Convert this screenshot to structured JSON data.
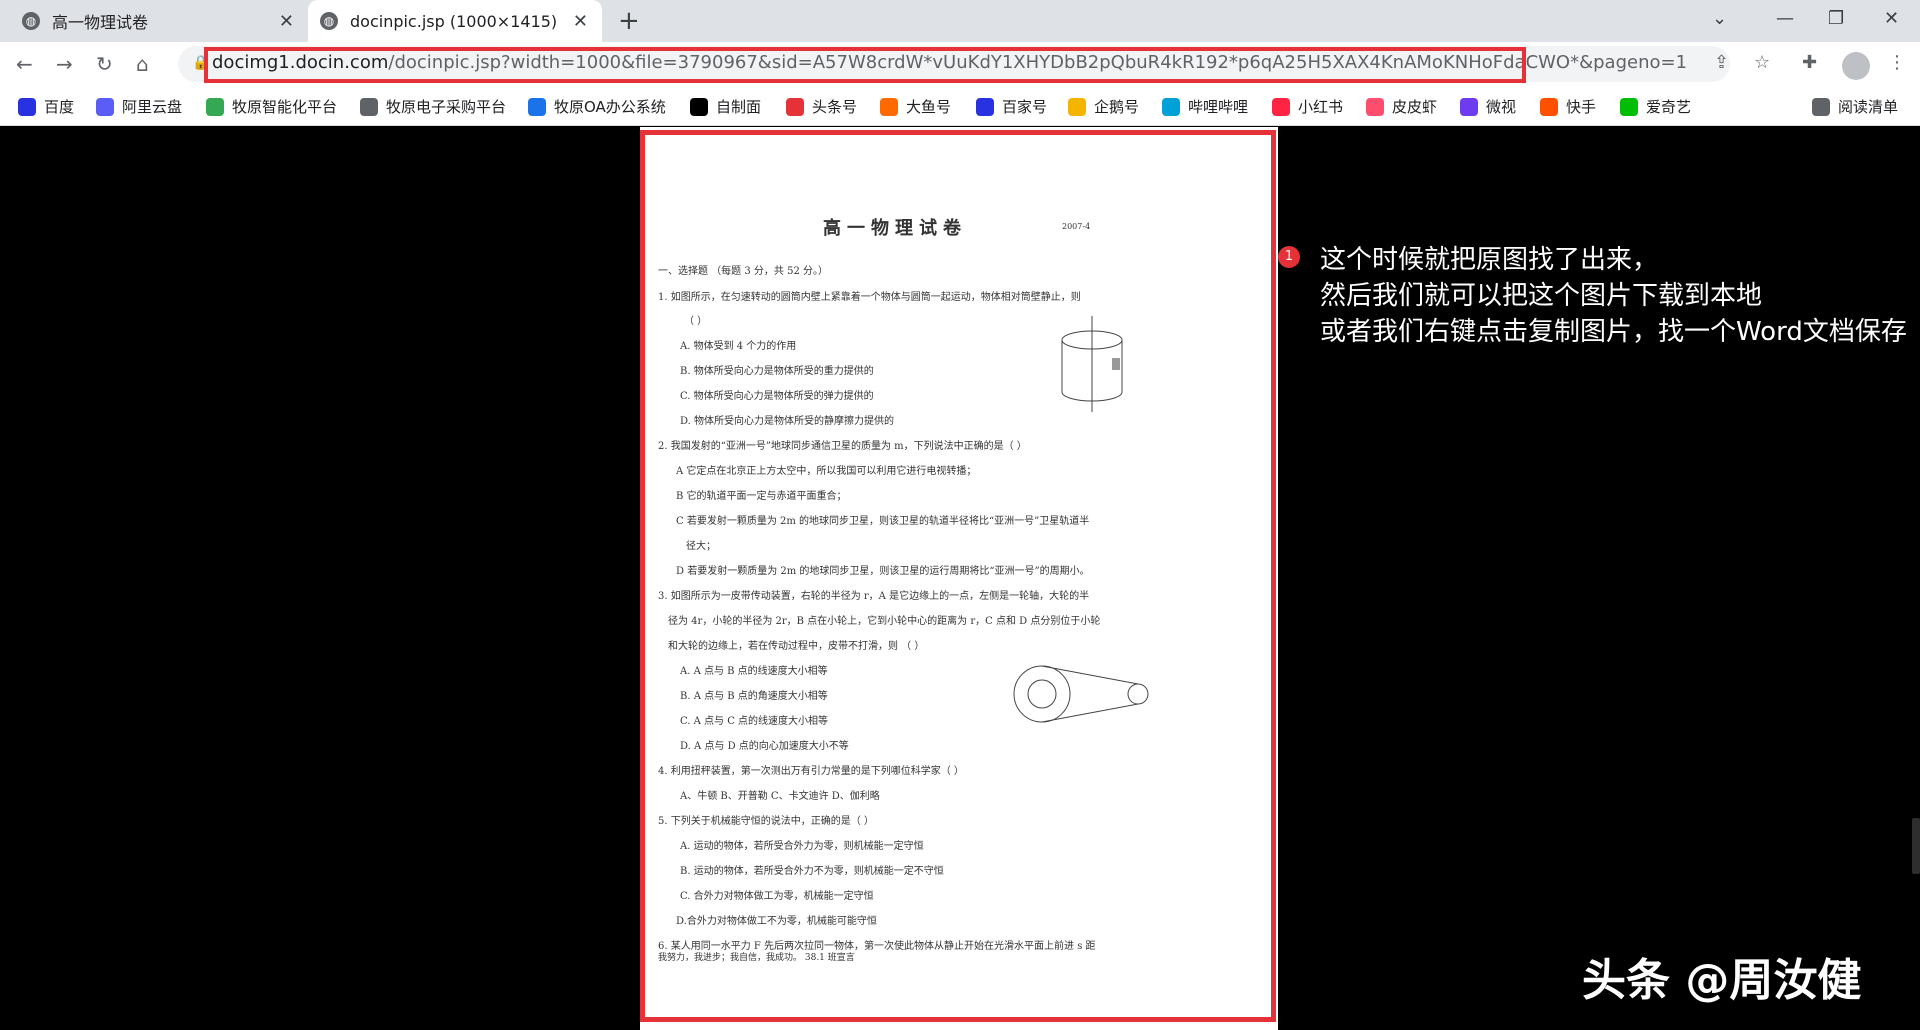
{
  "tabs": [
    {
      "title": "高一物理试卷"
    },
    {
      "title": "docinpic.jsp (1000×1415)"
    }
  ],
  "address": {
    "domain": "docimg1.docin.com",
    "path": "/docinpic.jsp?width=1000&file=3790967&sid=A57W8crdW*vUuKdY1XHYDbB2pQbuR4kR192*p6qA25H5XAX4KnAMoKNHoFdaCWO*&pageno=1"
  },
  "bookmarks": [
    {
      "label": "百度",
      "color": "#2932e1"
    },
    {
      "label": "阿里云盘",
      "color": "#5b5ef6"
    },
    {
      "label": "牧原智能化平台",
      "color": "#34a853"
    },
    {
      "label": "牧原电子采购平台",
      "color": "#5f6368"
    },
    {
      "label": "牧原OA办公系统",
      "color": "#1a73e8"
    },
    {
      "label": "自制面",
      "color": "#000000"
    },
    {
      "label": "头条号",
      "color": "#e53238"
    },
    {
      "label": "大鱼号",
      "color": "#ff6a00"
    },
    {
      "label": "百家号",
      "color": "#2932e1"
    },
    {
      "label": "企鹅号",
      "color": "#f4b400"
    },
    {
      "label": "哔哩哔哩",
      "color": "#00a1d6"
    },
    {
      "label": "小红书",
      "color": "#ff2442"
    },
    {
      "label": "皮皮虾",
      "color": "#ff4d6d"
    },
    {
      "label": "微视",
      "color": "#6e3cf0"
    },
    {
      "label": "快手",
      "color": "#ff5000"
    },
    {
      "label": "爱奇艺",
      "color": "#00be06"
    },
    {
      "label": "阅读清单",
      "color": "#5f6368"
    }
  ],
  "document": {
    "title": "高一物理试卷",
    "date": "2007-4",
    "lines": [
      "一、选择题 （每题 3 分，共 52 分。）",
      "1. 如图所示，在匀速转动的圆筒内壁上紧靠着一个物体与圆筒一起运动，物体相对筒壁静止，则",
      "（      ）",
      "A. 物体受到 4 个力的作用",
      "B. 物体所受向心力是物体所受的重力提供的",
      "C. 物体所受向心力是物体所受的弹力提供的",
      "D. 物体所受向心力是物体所受的静摩擦力提供的",
      "2. 我国发射的“亚洲一号”地球同步通信卫星的质量为 m，下列说法中正确的是（      ）",
      "A 它定点在北京正上方太空中，所以我国可以利用它进行电视转播；",
      "B 它的轨道平面一定与赤道平面重合；",
      "C 若要发射一颗质量为 2m 的地球同步卫星，则该卫星的轨道半径将比“亚洲一号”卫星轨道半",
      "径大；",
      "D 若要发射一颗质量为 2m 的地球同步卫星，则该卫星的运行周期将比“亚洲一号”的周期小。",
      "3. 如图所示为一皮带传动装置，右轮的半径为 r，A 是它边缘上的一点，左侧是一轮轴，大轮的半",
      "径为 4r，小轮的半径为 2r，B 点在小轮上，它到小轮中心的距离为 r，C 点和 D 点分别位于小轮",
      "和大轮的边缘上，若在传动过程中，皮带不打滑，则            （      ）",
      "A. A 点与 B 点的线速度大小相等",
      "B. A 点与 B 点的角速度大小相等",
      "C. A 点与 C 点的线速度大小相等",
      "D. A 点与 D 点的向心加速度大小不等",
      "4. 利用扭秤装置，第一次测出万有引力常量的是下列哪位科学家（      ）",
      "A、牛顿      B、开普勒    C、卡文迪许      D、伽利略",
      "5.   下列关于机械能守恒的说法中，正确的是（      ）",
      "A. 运动的物体，若所受合外力为零，则机械能一定守恒",
      "B. 运动的物体，若所受合外力不为零，则机械能一定不守恒",
      "C. 合外力对物体做工为零，机械能一定守恒",
      "D.合外力对物体做工不为零，机械能可能守恒",
      "6. 某人用同一水平力 F 先后两次拉同一物体，第一次使此物体从静止开始在光滑水平面上前进 s 距",
      "我努力，我进步；我自信，我成功。                                 38.1 班宣言"
    ]
  },
  "annotation": {
    "number": "1",
    "lines": [
      "这个时候就把原图找了出来，",
      "然后我们就可以把这个图片下载到本地",
      "或者我们右键点击复制图片，找一个Word文档保存"
    ]
  },
  "watermark": "头条 @周汝健"
}
